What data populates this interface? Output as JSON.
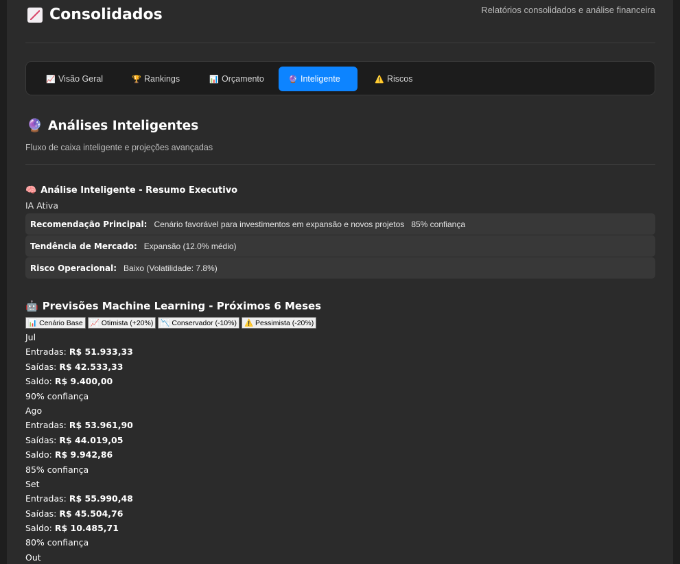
{
  "header": {
    "title": "Consolidados",
    "subtitle": "Relatórios consolidados e análise financeira"
  },
  "tabs": [
    {
      "icon": "📈",
      "label": "Visão Geral"
    },
    {
      "icon": "🏆",
      "label": "Rankings"
    },
    {
      "icon": "📊",
      "label": "Orçamento"
    },
    {
      "icon": "🔮",
      "label": "Inteligente",
      "active": true
    },
    {
      "icon": "⚠️",
      "label": "Riscos"
    }
  ],
  "section": {
    "title": "Análises Inteligentes",
    "subtitle": "Fluxo de caixa inteligente e projeções avançadas"
  },
  "ai_summary": {
    "title": "Análise Inteligente - Resumo Executivo",
    "status": "IA Ativa",
    "rows": [
      {
        "label": "Recomendação Principal:",
        "value": "Cenário favorável para investimentos em expansão e novos projetos",
        "extra": "85% confiança"
      },
      {
        "label": "Tendência de Mercado:",
        "value": "Expansão (12.0% médio)"
      },
      {
        "label": "Risco Operacional:",
        "value": "Baixo (Volatilidade: 7.8%)"
      }
    ]
  },
  "ml": {
    "title": "Previsões Machine Learning - Próximos 6 Meses",
    "scenarios": [
      {
        "icon": "📊",
        "label": "Cenário Base"
      },
      {
        "icon": "📈",
        "label": "Otimista (+20%)"
      },
      {
        "icon": "📉",
        "label": "Conservador (-10%)"
      },
      {
        "icon": "⚠️",
        "label": "Pessimista (-20%)"
      }
    ],
    "labels": {
      "entradas": "Entradas:",
      "saidas": "Saídas:",
      "saldo": "Saldo:"
    },
    "months": [
      {
        "month": "Jul",
        "entradas": "R$ 51.933,33",
        "saidas": "R$ 42.533,33",
        "saldo": "R$ 9.400,00",
        "confidence": "90% confiança"
      },
      {
        "month": "Ago",
        "entradas": "R$ 53.961,90",
        "saidas": "R$ 44.019,05",
        "saldo": "R$ 9.942,86",
        "confidence": "85% confiança"
      },
      {
        "month": "Set",
        "entradas": "R$ 55.990,48",
        "saidas": "R$ 45.504,76",
        "saldo": "R$ 10.485,71",
        "confidence": "80% confiança"
      },
      {
        "month": "Out"
      }
    ]
  }
}
